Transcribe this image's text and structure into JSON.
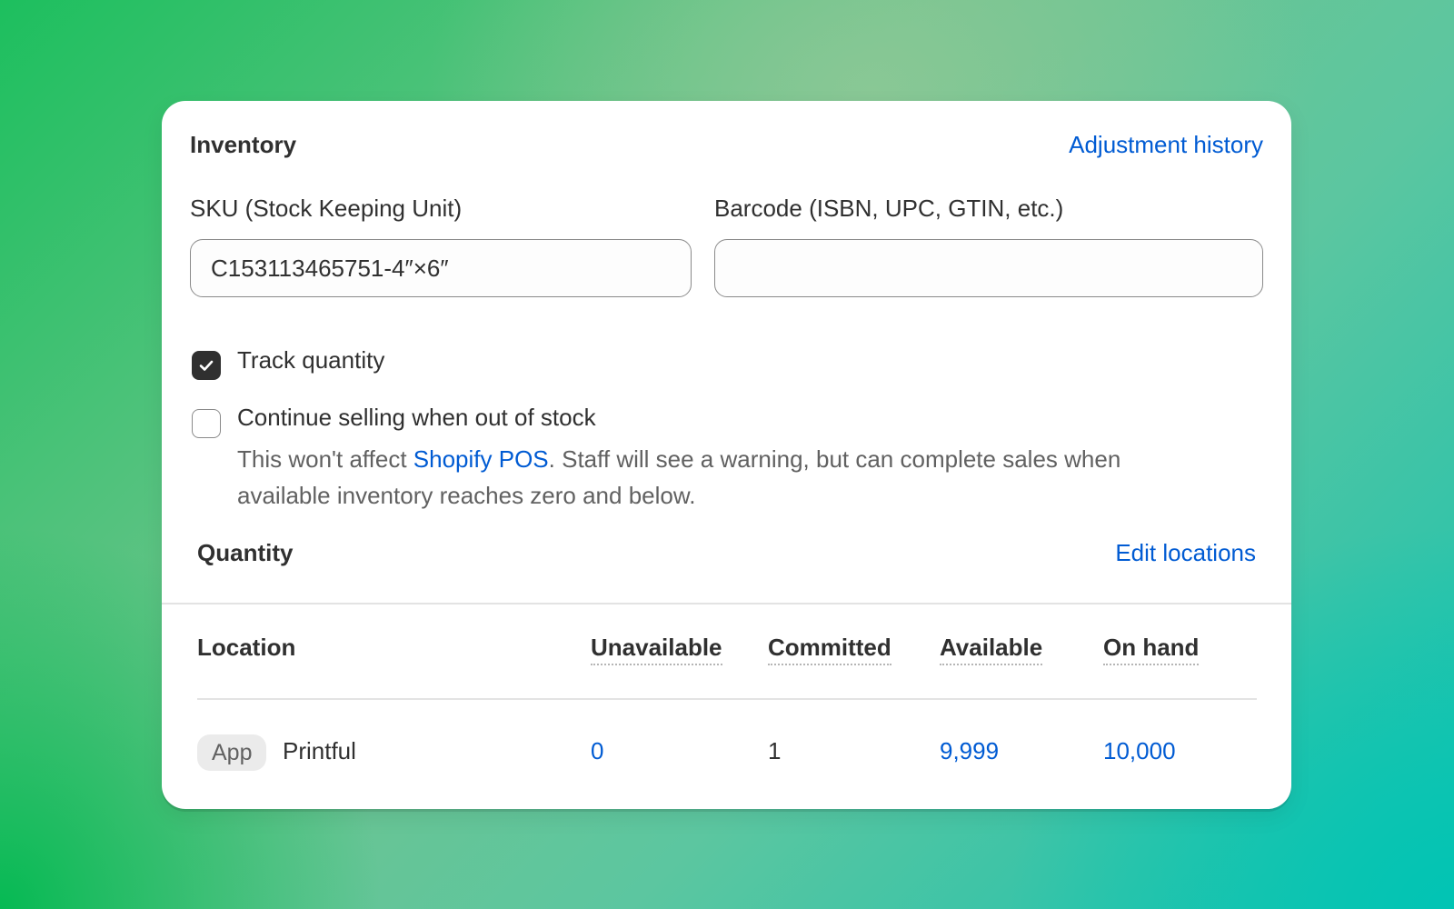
{
  "inventory": {
    "title": "Inventory",
    "adjustment_history_link": "Adjustment history",
    "sku": {
      "label": "SKU (Stock Keeping Unit)",
      "value": "C153113465751-4″×6″"
    },
    "barcode": {
      "label": "Barcode (ISBN, UPC, GTIN, etc.)",
      "value": ""
    },
    "track_quantity": {
      "label": "Track quantity",
      "checked": true
    },
    "continue_selling": {
      "label": "Continue selling when out of stock",
      "checked": false,
      "help_prefix": "This won't affect ",
      "help_link": "Shopify POS",
      "help_suffix": ". Staff will see a warning, but can complete sales when available inventory reaches zero and below."
    }
  },
  "quantity": {
    "title": "Quantity",
    "edit_locations_link": "Edit locations",
    "columns": {
      "location": "Location",
      "unavailable": "Unavailable",
      "committed": "Committed",
      "available": "Available",
      "on_hand": "On hand"
    },
    "rows": [
      {
        "badge": "App",
        "location": "Printful",
        "unavailable": "0",
        "committed": "1",
        "available": "9,999",
        "on_hand": "10,000"
      }
    ]
  },
  "colors": {
    "link": "#005bd3",
    "text": "#303030",
    "muted": "#616161"
  }
}
